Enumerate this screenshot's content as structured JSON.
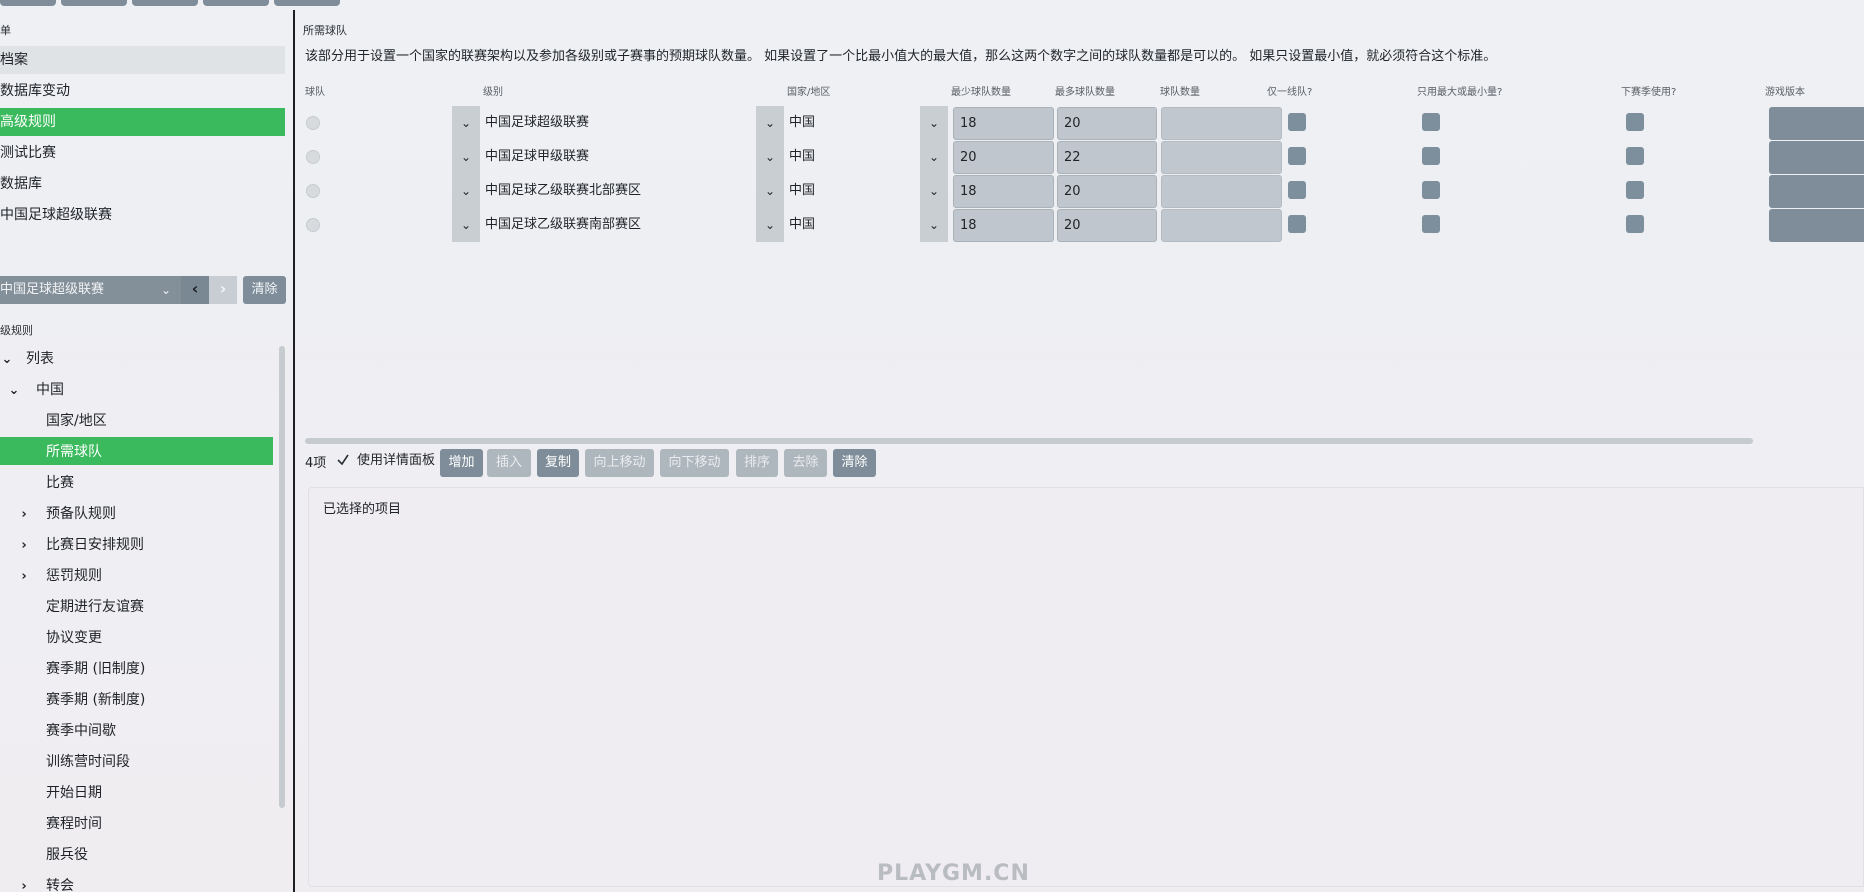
{
  "left": {
    "section_title": "单",
    "menu": [
      {
        "label": "档案",
        "state": "hover"
      },
      {
        "label": "数据库变动",
        "state": "normal"
      },
      {
        "label": "高级规则",
        "state": "selected"
      },
      {
        "label": "测试比赛",
        "state": "normal"
      },
      {
        "label": "数据库",
        "state": "normal"
      },
      {
        "label": "中国足球超级联赛",
        "state": "normal"
      }
    ],
    "selector": {
      "value": "中国足球超级联赛",
      "clear_label": "清除"
    },
    "tree_title": "级规则",
    "tree": [
      {
        "label": "列表",
        "chevron": "down"
      },
      {
        "label": "中国",
        "chevron": "down"
      },
      {
        "label": "国家/地区",
        "chevron": ""
      },
      {
        "label": "所需球队",
        "chevron": "",
        "selected": true
      },
      {
        "label": "比赛",
        "chevron": ""
      },
      {
        "label": "预备队规则",
        "chevron": "right"
      },
      {
        "label": "比赛日安排规则",
        "chevron": "right"
      },
      {
        "label": "惩罚规则",
        "chevron": "right"
      },
      {
        "label": "定期进行友谊赛",
        "chevron": ""
      },
      {
        "label": "协议变更",
        "chevron": ""
      },
      {
        "label": "赛季期 (旧制度)",
        "chevron": ""
      },
      {
        "label": "赛季期 (新制度)",
        "chevron": ""
      },
      {
        "label": "赛季中间歇",
        "chevron": ""
      },
      {
        "label": "训练营时间段",
        "chevron": ""
      },
      {
        "label": "开始日期",
        "chevron": ""
      },
      {
        "label": "赛程时间",
        "chevron": ""
      },
      {
        "label": "服兵役",
        "chevron": ""
      },
      {
        "label": "转会",
        "chevron": "right"
      }
    ]
  },
  "main": {
    "title": "所需球队",
    "description": "该部分用于设置一个国家的联赛架构以及参加各级别或子赛事的预期球队数量。 如果设置了一个比最小值大的最大值，那么这两个数字之间的球队数量都是可以的。 如果只设置最小值，就必须符合这个标准。",
    "columns": [
      "球队",
      "级别",
      "国家/地区",
      "最少球队数量",
      "最多球队数量",
      "球队数量",
      "仅一线队?",
      "只用最大或最小量?",
      "下赛季使用?",
      "游戏版本"
    ],
    "rows": [
      {
        "level": "中国足球超级联赛",
        "nation": "中国",
        "min": "18",
        "max": "20"
      },
      {
        "level": "中国足球甲级联赛",
        "nation": "中国",
        "min": "20",
        "max": "22"
      },
      {
        "level": "中国足球乙级联赛北部赛区",
        "nation": "中国",
        "min": "18",
        "max": "20"
      },
      {
        "level": "中国足球乙级联赛南部赛区",
        "nation": "中国",
        "min": "18",
        "max": "20"
      }
    ],
    "toolbar": {
      "count": "4项",
      "detail_label": "使用详情面板",
      "detail_checked": true,
      "add": "增加",
      "insert": "插入",
      "copy": "复制",
      "move_up": "向上移动",
      "move_down": "向下移动",
      "sort": "排序",
      "remove": "去除",
      "clear": "清除"
    },
    "selected_panel_title": "已选择的项目"
  },
  "watermark": "PLAYGM.CN",
  "colors": {
    "accent": "#3aba5c",
    "button": "#7e8d99",
    "field": "#bfc6cd"
  }
}
